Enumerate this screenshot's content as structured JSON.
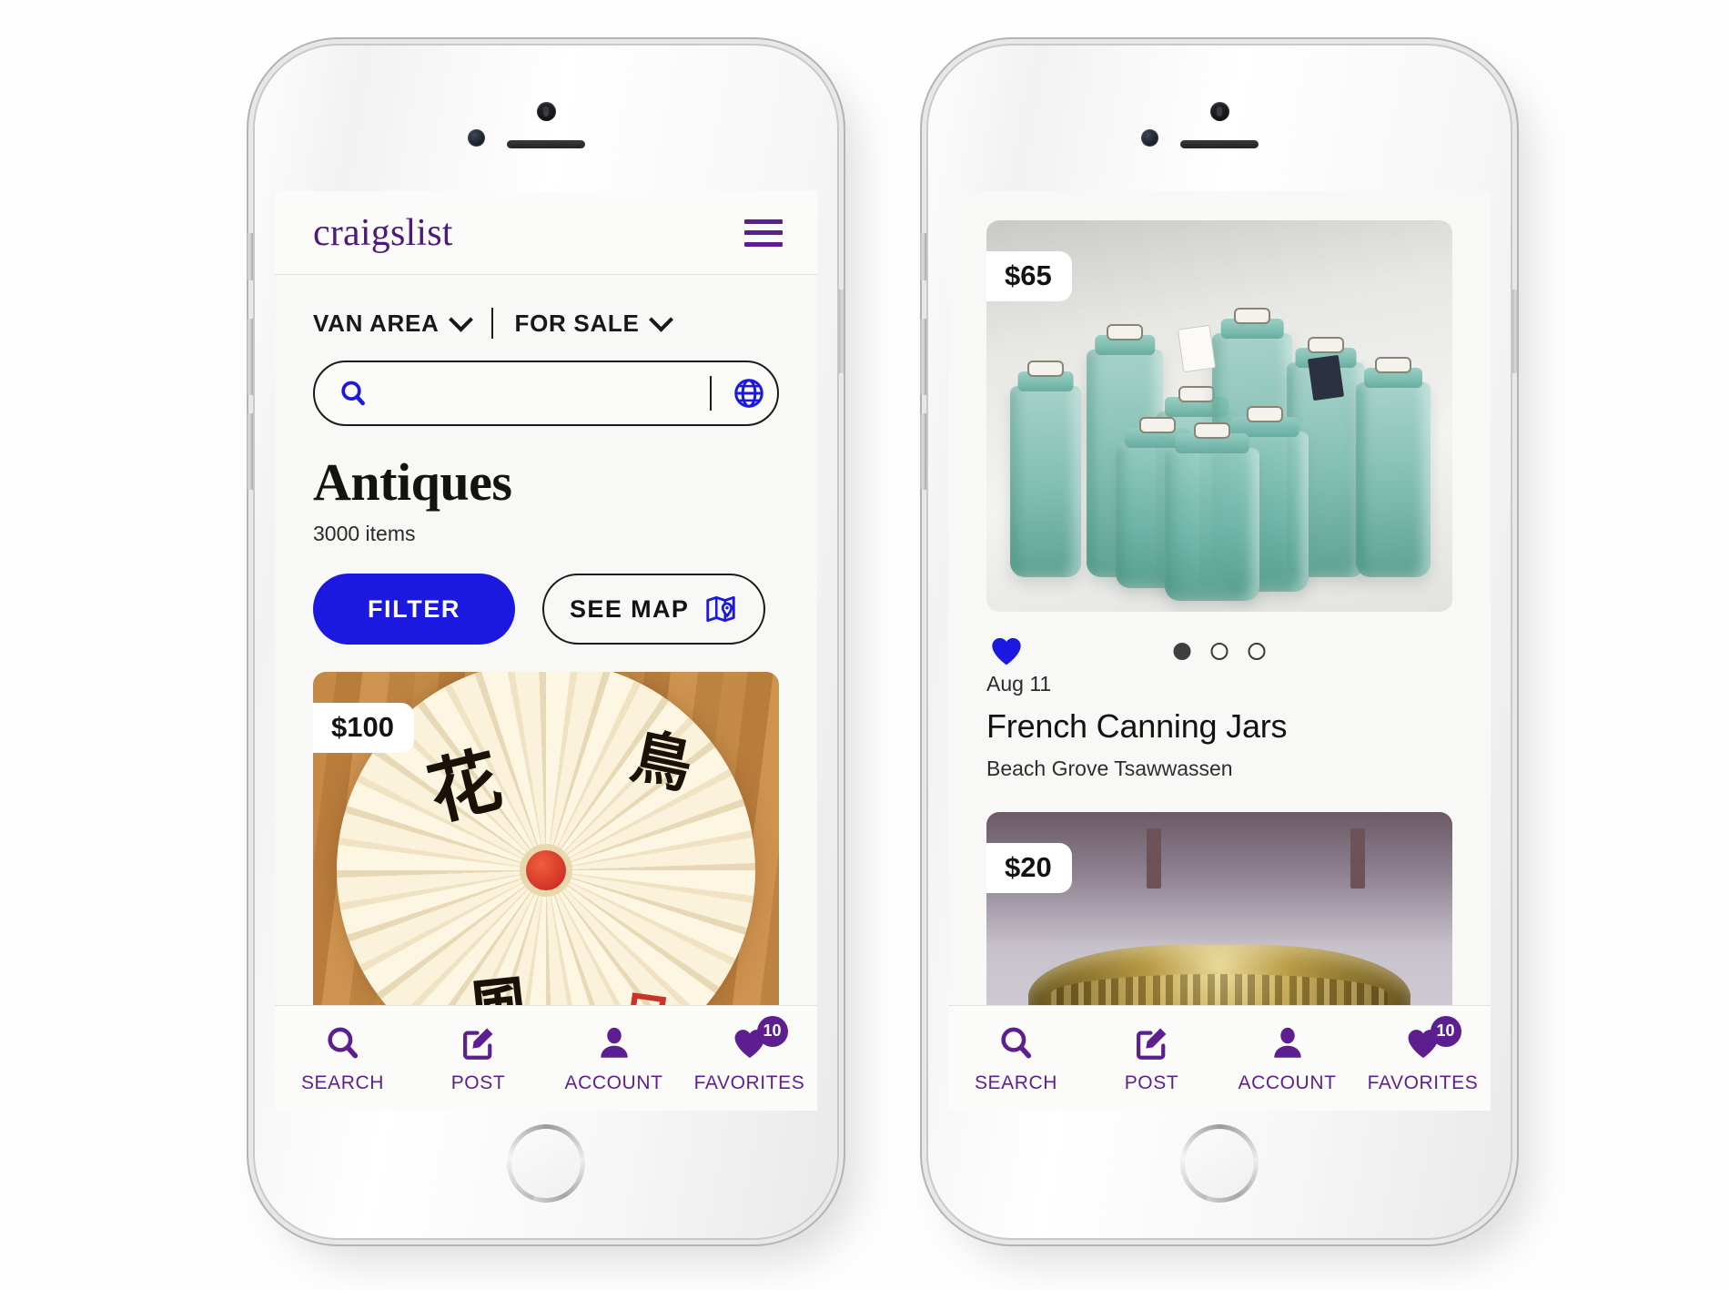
{
  "app": {
    "brand": "craigslist",
    "menu_icon": "hamburger-icon"
  },
  "filters": {
    "location": "VAN AREA",
    "category": "FOR SALE"
  },
  "search": {
    "value": "",
    "placeholder": "",
    "search_icon": "search-icon",
    "globe_icon": "globe-icon"
  },
  "page": {
    "title": "Antiques",
    "item_count": "3000 items"
  },
  "actions": {
    "filter_label": "FILTER",
    "map_label": "SEE MAP",
    "map_icon": "map-pin-icon"
  },
  "listings": [
    {
      "price": "$100",
      "image_alt": "paper fan with calligraphy on wood floor"
    },
    {
      "price": "$65",
      "image_alt": "green glass french canning jars",
      "favorited": true,
      "carousel": {
        "count": 3,
        "active": 0
      },
      "date": "Aug 11",
      "title": "French Canning Jars",
      "location": "Beach Grove Tsawwassen"
    },
    {
      "price": "$20",
      "image_alt": "engraved brass bowl"
    }
  ],
  "tabbar": [
    {
      "label": "SEARCH",
      "icon": "search-icon",
      "badge": ""
    },
    {
      "label": "POST",
      "icon": "compose-icon",
      "badge": ""
    },
    {
      "label": "ACCOUNT",
      "icon": "person-icon",
      "badge": ""
    },
    {
      "label": "FAVORITES",
      "icon": "heart-icon",
      "badge": "10"
    }
  ],
  "colors": {
    "brand_purple": "#5d1f8f",
    "accent_blue": "#1b18e0",
    "text_dark": "#131313",
    "screen_bg": "#f8f8f6"
  }
}
